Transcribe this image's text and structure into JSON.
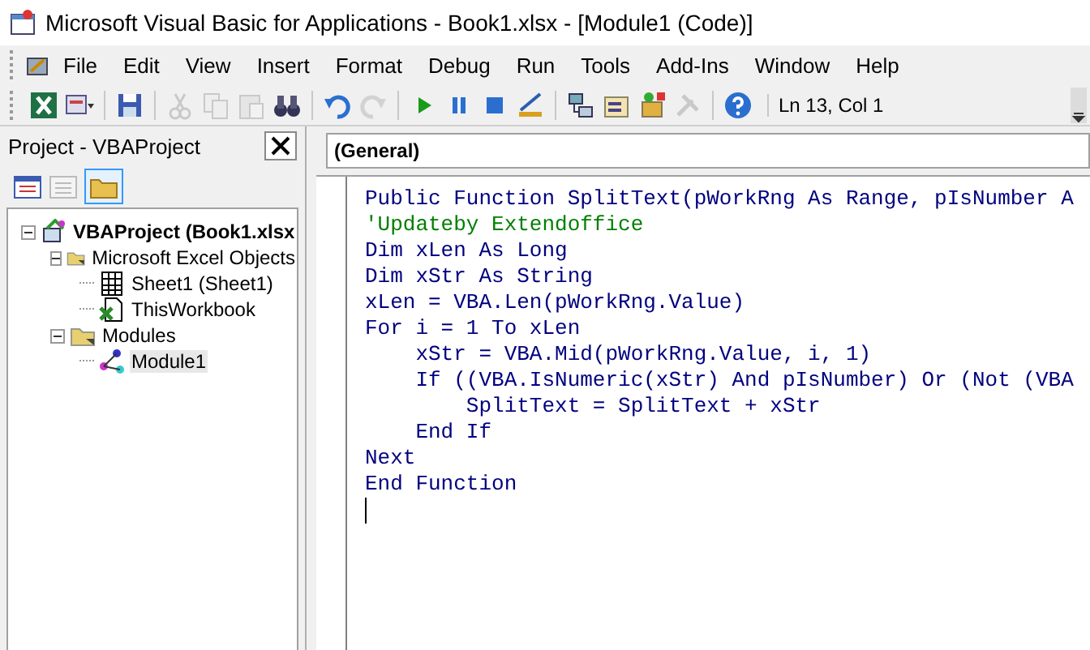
{
  "window": {
    "title": "Microsoft Visual Basic for Applications - Book1.xlsx - [Module1 (Code)]"
  },
  "menu_bar": [
    {
      "label": "File"
    },
    {
      "label": "Edit"
    },
    {
      "label": "View"
    },
    {
      "label": "Insert"
    },
    {
      "label": "Format"
    },
    {
      "label": "Debug"
    },
    {
      "label": "Run"
    },
    {
      "label": "Tools"
    },
    {
      "label": "Add-Ins"
    },
    {
      "label": "Window"
    },
    {
      "label": "Help"
    }
  ],
  "toolbar": {
    "items": [
      {
        "kind": "excel",
        "disabled": false
      },
      {
        "kind": "insert",
        "disabled": false
      },
      {
        "kind": "sep"
      },
      {
        "kind": "save",
        "disabled": false
      },
      {
        "kind": "sep"
      },
      {
        "kind": "cut",
        "disabled": true
      },
      {
        "kind": "copy",
        "disabled": true
      },
      {
        "kind": "paste",
        "disabled": true
      },
      {
        "kind": "find",
        "disabled": false
      },
      {
        "kind": "sep"
      },
      {
        "kind": "undo",
        "disabled": false
      },
      {
        "kind": "redo",
        "disabled": true
      },
      {
        "kind": "sep"
      },
      {
        "kind": "run",
        "disabled": false
      },
      {
        "kind": "pause",
        "disabled": false
      },
      {
        "kind": "stop",
        "disabled": false
      },
      {
        "kind": "design",
        "disabled": false
      },
      {
        "kind": "sep"
      },
      {
        "kind": "explorer",
        "disabled": false
      },
      {
        "kind": "properties",
        "disabled": false
      },
      {
        "kind": "objects",
        "disabled": false
      },
      {
        "kind": "toolbox",
        "disabled": true
      },
      {
        "kind": "sep"
      },
      {
        "kind": "help",
        "disabled": false
      }
    ],
    "position": "Ln 13, Col 1"
  },
  "project_panel": {
    "title": "Project - VBAProject",
    "toggle_folders": {
      "selected": true
    },
    "tree": [
      {
        "label": "VBAProject (Book1.xlsx",
        "kind": "project",
        "expanded": true,
        "selected": false,
        "children": [
          {
            "label": "Microsoft Excel Objects",
            "kind": "folder",
            "expanded": true,
            "selected": false,
            "children": [
              {
                "label": "Sheet1 (Sheet1)",
                "kind": "sheet",
                "selected": false
              },
              {
                "label": "ThisWorkbook",
                "kind": "workbook",
                "selected": false
              }
            ]
          },
          {
            "label": "Modules",
            "kind": "folder",
            "expanded": true,
            "selected": false,
            "children": [
              {
                "label": "Module1",
                "kind": "module",
                "selected": true
              }
            ]
          }
        ]
      }
    ]
  },
  "code_window": {
    "object_box": "(General)",
    "lines": [
      {
        "kind": "code",
        "text": "Public Function SplitText(pWorkRng As Range, pIsNumber A"
      },
      {
        "kind": "comment",
        "text": "'Updateby Extendoffice"
      },
      {
        "kind": "code",
        "text": "Dim xLen As Long"
      },
      {
        "kind": "code",
        "text": "Dim xStr As String"
      },
      {
        "kind": "code",
        "text": "xLen = VBA.Len(pWorkRng.Value)"
      },
      {
        "kind": "code",
        "text": "For i = 1 To xLen"
      },
      {
        "kind": "code",
        "text": "    xStr = VBA.Mid(pWorkRng.Value, i, 1)"
      },
      {
        "kind": "code",
        "text": "    If ((VBA.IsNumeric(xStr) And pIsNumber) Or (Not (VBA"
      },
      {
        "kind": "code",
        "text": "        SplitText = SplitText + xStr"
      },
      {
        "kind": "code",
        "text": "    End If"
      },
      {
        "kind": "code",
        "text": "Next"
      },
      {
        "kind": "code",
        "text": "End Function"
      }
    ],
    "cursor_visible": true
  }
}
